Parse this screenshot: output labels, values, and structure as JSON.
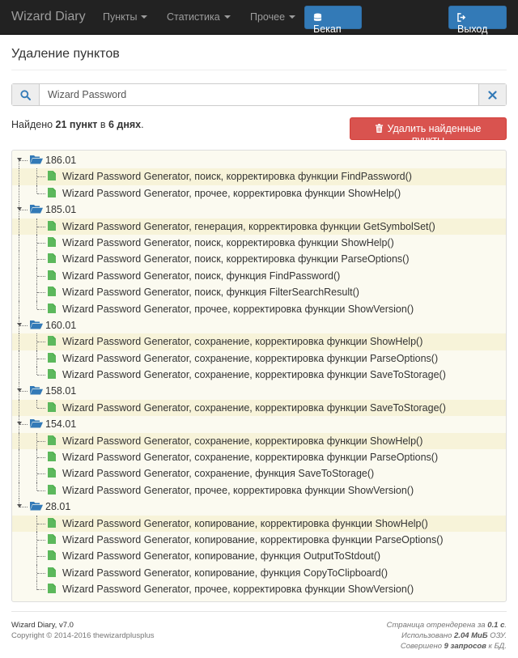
{
  "navbar": {
    "brand": "Wizard Diary",
    "items": [
      "Пункты",
      "Статистика",
      "Прочее"
    ],
    "backup_label": "Бекап",
    "logout_label": "Выход",
    "colors": {
      "bg": "#222222",
      "primary": "#337ab7",
      "danger": "#d9534f"
    }
  },
  "page": {
    "title": "Удаление пунктов"
  },
  "search": {
    "value": "Wizard Password",
    "placeholder": ""
  },
  "summary": {
    "prefix": "Найдено ",
    "count": "21 пункт",
    "middle": " в ",
    "days": "6 днях",
    "suffix": "."
  },
  "delete_button": {
    "label": "Удалить найденные пункты"
  },
  "tree": [
    {
      "date": "186.01",
      "items": [
        "Wizard Password Generator, поиск, корректировка функции FindPassword()",
        "Wizard Password Generator, прочее, корректировка функции ShowHelp()"
      ]
    },
    {
      "date": "185.01",
      "items": [
        "Wizard Password Generator, генерация, корректировка функции GetSymbolSet()",
        "Wizard Password Generator, поиск, корректировка функции ShowHelp()",
        "Wizard Password Generator, поиск, корректировка функции ParseOptions()",
        "Wizard Password Generator, поиск, функция FindPassword()",
        "Wizard Password Generator, поиск, функция FilterSearchResult()",
        "Wizard Password Generator, прочее, корректировка функции ShowVersion()"
      ]
    },
    {
      "date": "160.01",
      "items": [
        "Wizard Password Generator, сохранение, корректировка функции ShowHelp()",
        "Wizard Password Generator, сохранение, корректировка функции ParseOptions()",
        "Wizard Password Generator, сохранение, корректировка функции SaveToStorage()"
      ]
    },
    {
      "date": "158.01",
      "items": [
        "Wizard Password Generator, сохранение, корректировка функции SaveToStorage()"
      ]
    },
    {
      "date": "154.01",
      "items": [
        "Wizard Password Generator, сохранение, корректировка функции ShowHelp()",
        "Wizard Password Generator, сохранение, корректировка функции ParseOptions()",
        "Wizard Password Generator, сохранение, функция SaveToStorage()",
        "Wizard Password Generator, прочее, корректировка функции ShowVersion()"
      ]
    },
    {
      "date": "28.01",
      "items": [
        "Wizard Password Generator, копирование, корректировка функции ShowHelp()",
        "Wizard Password Generator, копирование, корректировка функции ParseOptions()",
        "Wizard Password Generator, копирование, функция OutputToStdout()",
        "Wizard Password Generator, копирование, функция CopyToClipboard()",
        "Wizard Password Generator, прочее, корректировка функции ShowVersion()"
      ]
    }
  ],
  "footer": {
    "version": "Wizard Diary, v7.0",
    "copyright": "Copyright © 2014-2016 thewizardplusplus",
    "render_prefix": "Страница отрендерена за ",
    "render_time": "0.1 с",
    "render_suffix": ".",
    "memory_prefix": "Использовано ",
    "memory": "2.04 МиБ",
    "memory_suffix": " ОЗУ.",
    "queries_prefix": "Совершено ",
    "queries": "9 запросов",
    "queries_suffix": " к БД."
  }
}
